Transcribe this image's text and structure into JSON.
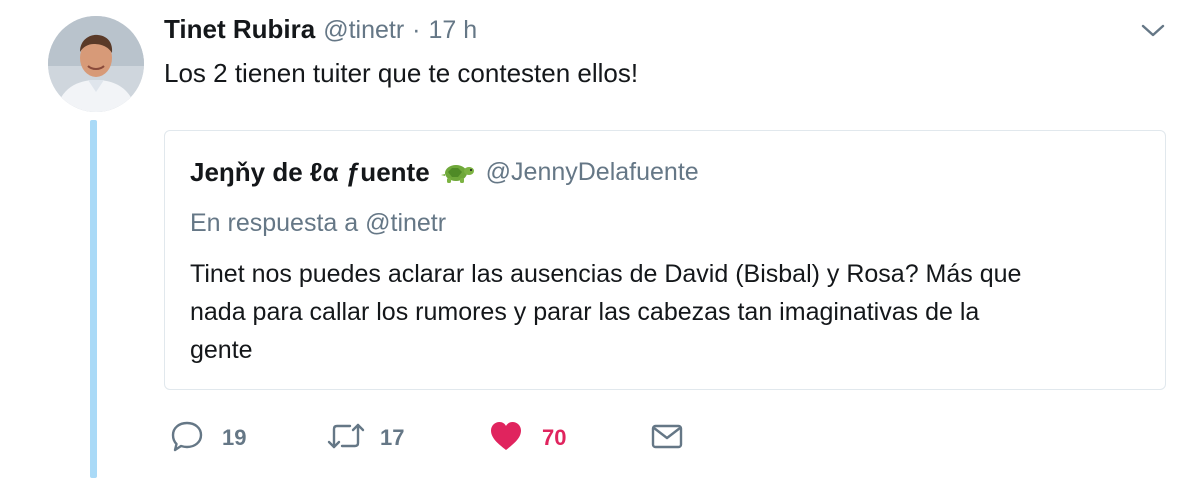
{
  "tweet": {
    "author_name": "Tinet Rubira",
    "author_handle": "@tinetr",
    "separator": "·",
    "time": "17 h",
    "text": "Los 2 tienen tuiter que te contesten ellos!",
    "avatar_icon": "avatar-photo",
    "caret_icon": "chevron-down-icon"
  },
  "quote": {
    "author_name": "Jeŋňy de ℓα ƒuente",
    "emoji_icon": "turtle-icon",
    "author_handle": "@JennyDelafuente",
    "reply_prefix": "En respuesta a",
    "reply_mention": "@tinetr",
    "text_lines": [
      "Tinet nos puedes aclarar las ausencias de David (Bisbal)  y Rosa?  Más que",
      "nada para callar los rumores y parar las cabezas tan imaginativas de la",
      "gente"
    ]
  },
  "actions": {
    "reply_count": "19",
    "retweet_count": "17",
    "like_count": "70"
  },
  "colors": {
    "text": "#14171a",
    "secondary": "#657786",
    "border": "#e1e8ed",
    "thread_line": "#aadaf7",
    "like": "#e0245e",
    "turtle": "#5a8f2e"
  }
}
